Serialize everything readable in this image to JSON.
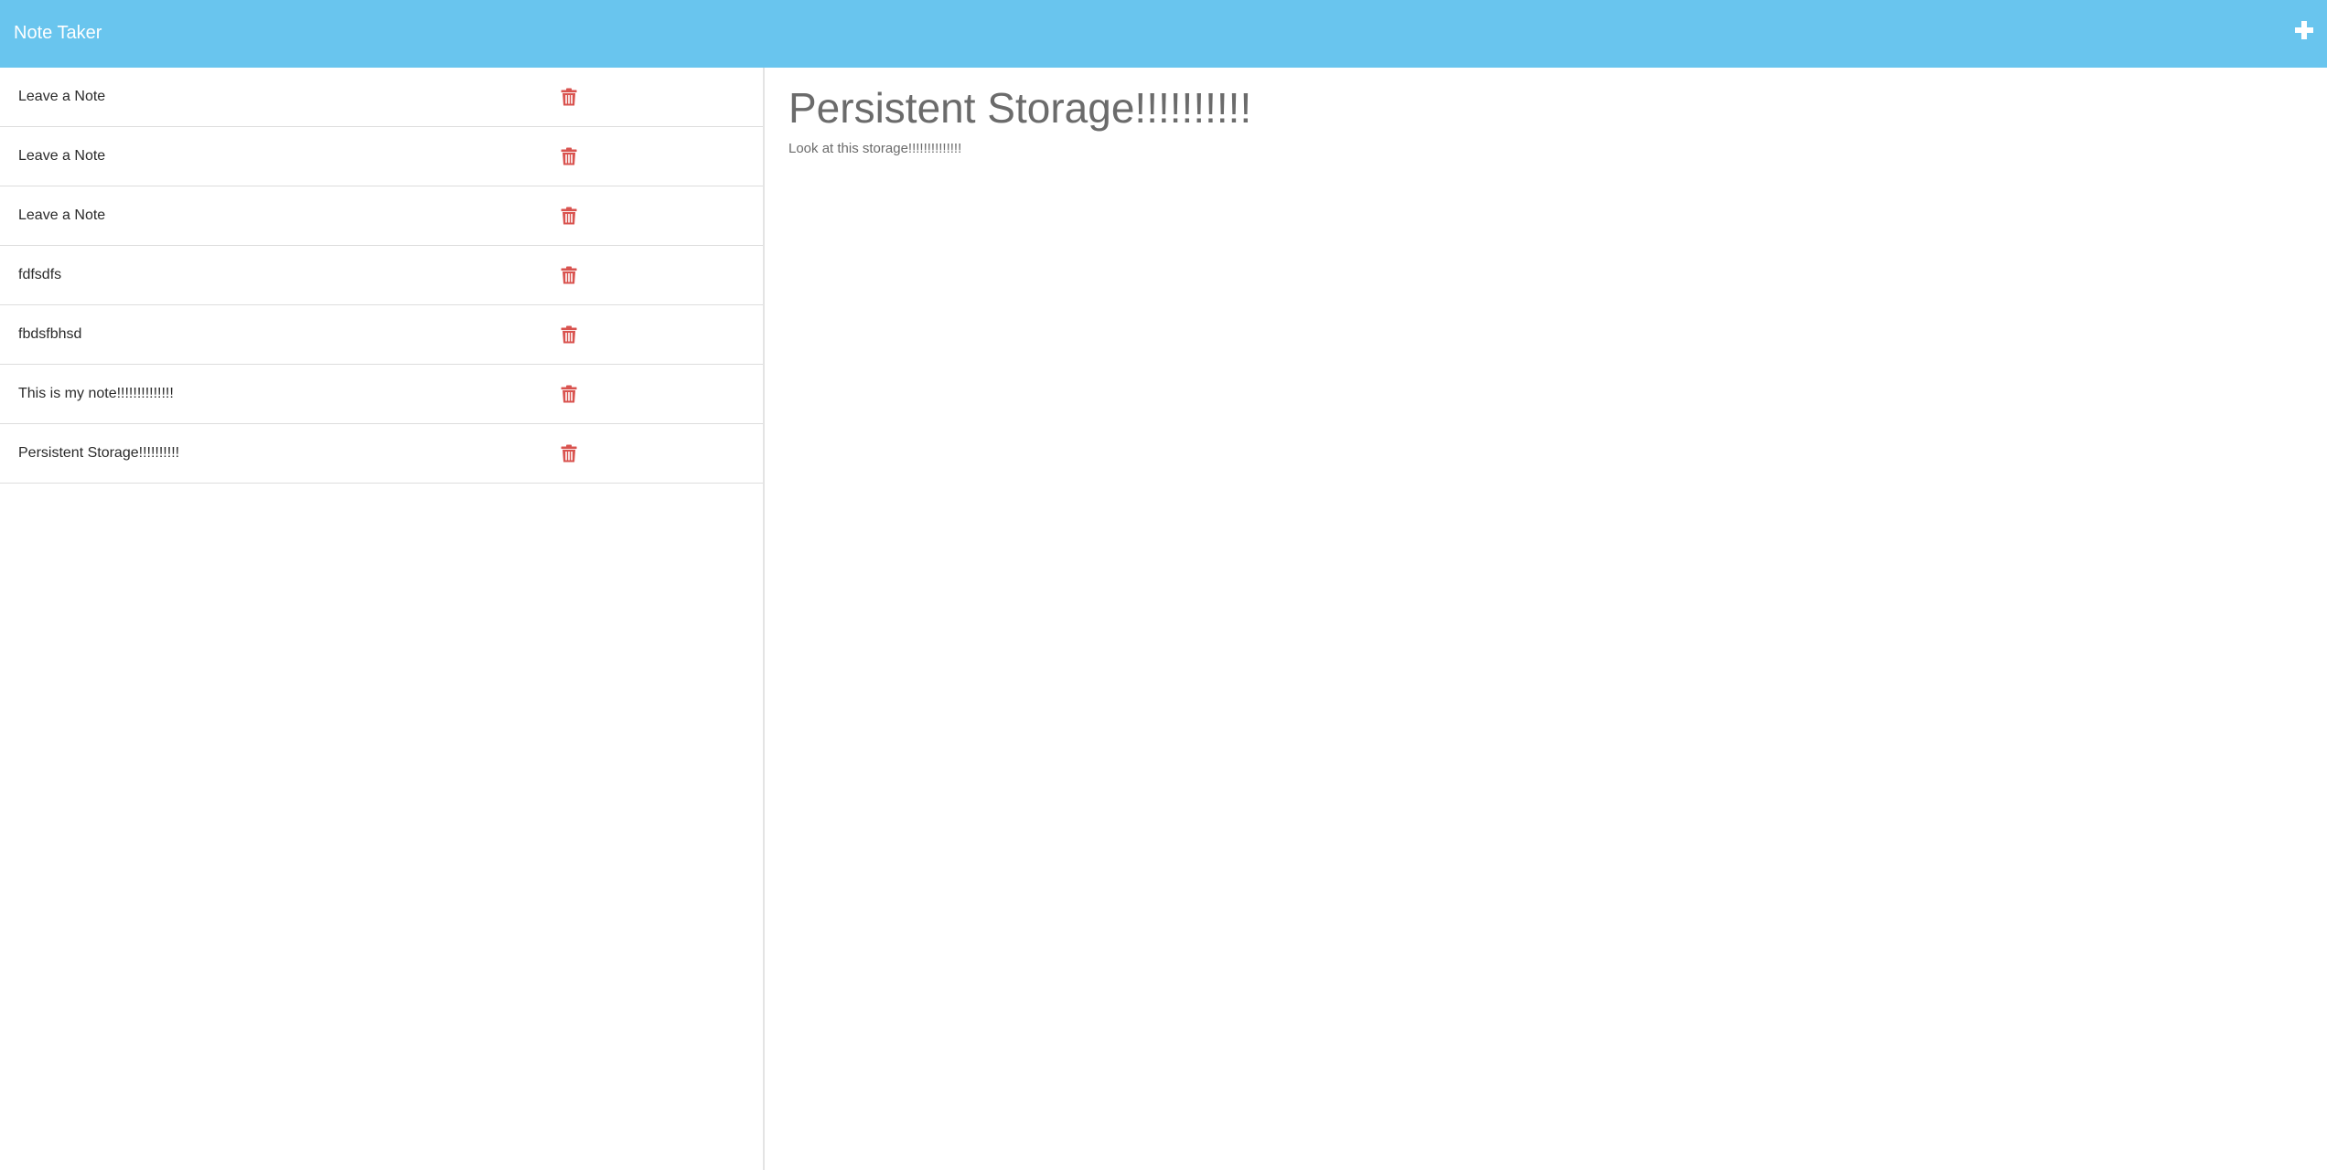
{
  "navbar": {
    "brand": "Note Taker",
    "new_note_icon": "plus-icon"
  },
  "colors": {
    "navbar_bg": "#69c5ee",
    "delete_icon": "#d9534f",
    "text_muted": "#6b6b6b"
  },
  "sidebar": {
    "notes": [
      {
        "title": "Leave a Note",
        "delete_icon": "trash-icon"
      },
      {
        "title": "Leave a Note",
        "delete_icon": "trash-icon"
      },
      {
        "title": "Leave a Note",
        "delete_icon": "trash-icon"
      },
      {
        "title": "fdfsdfs",
        "delete_icon": "trash-icon"
      },
      {
        "title": "fbdsfbhsd",
        "delete_icon": "trash-icon"
      },
      {
        "title": "This is my note!!!!!!!!!!!!!!",
        "delete_icon": "trash-icon"
      },
      {
        "title": "Persistent Storage!!!!!!!!!!",
        "delete_icon": "trash-icon"
      }
    ]
  },
  "editor": {
    "title_value": "Persistent Storage!!!!!!!!!!",
    "body_value": "Look at this storage!!!!!!!!!!!!!!"
  }
}
